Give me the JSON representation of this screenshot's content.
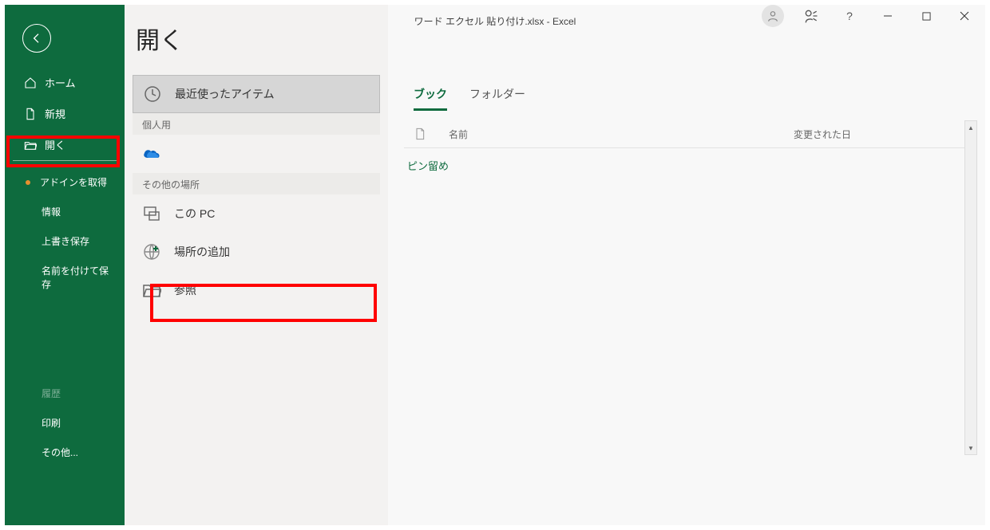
{
  "titlebar": {
    "title": "ワード エクセル 貼り付け.xlsx  -  Excel"
  },
  "sidebar": {
    "home": "ホーム",
    "new": "新規",
    "open": "開く",
    "addins": "アドインを取得",
    "info": "情報",
    "save": "上書き保存",
    "saveas": "名前を付けて保存",
    "history": "履歴",
    "print": "印刷",
    "other": "その他..."
  },
  "page": {
    "title": "開く"
  },
  "places": {
    "recent": "最近使ったアイテム",
    "section_personal": "個人用",
    "section_other": "その他の場所",
    "thispc": "この PC",
    "addlocation": "場所の追加",
    "browse": "参照"
  },
  "tabs": {
    "book": "ブック",
    "folder": "フォルダー"
  },
  "filelist": {
    "col_name": "名前",
    "col_date": "変更された日",
    "pinned": "ピン留め"
  }
}
